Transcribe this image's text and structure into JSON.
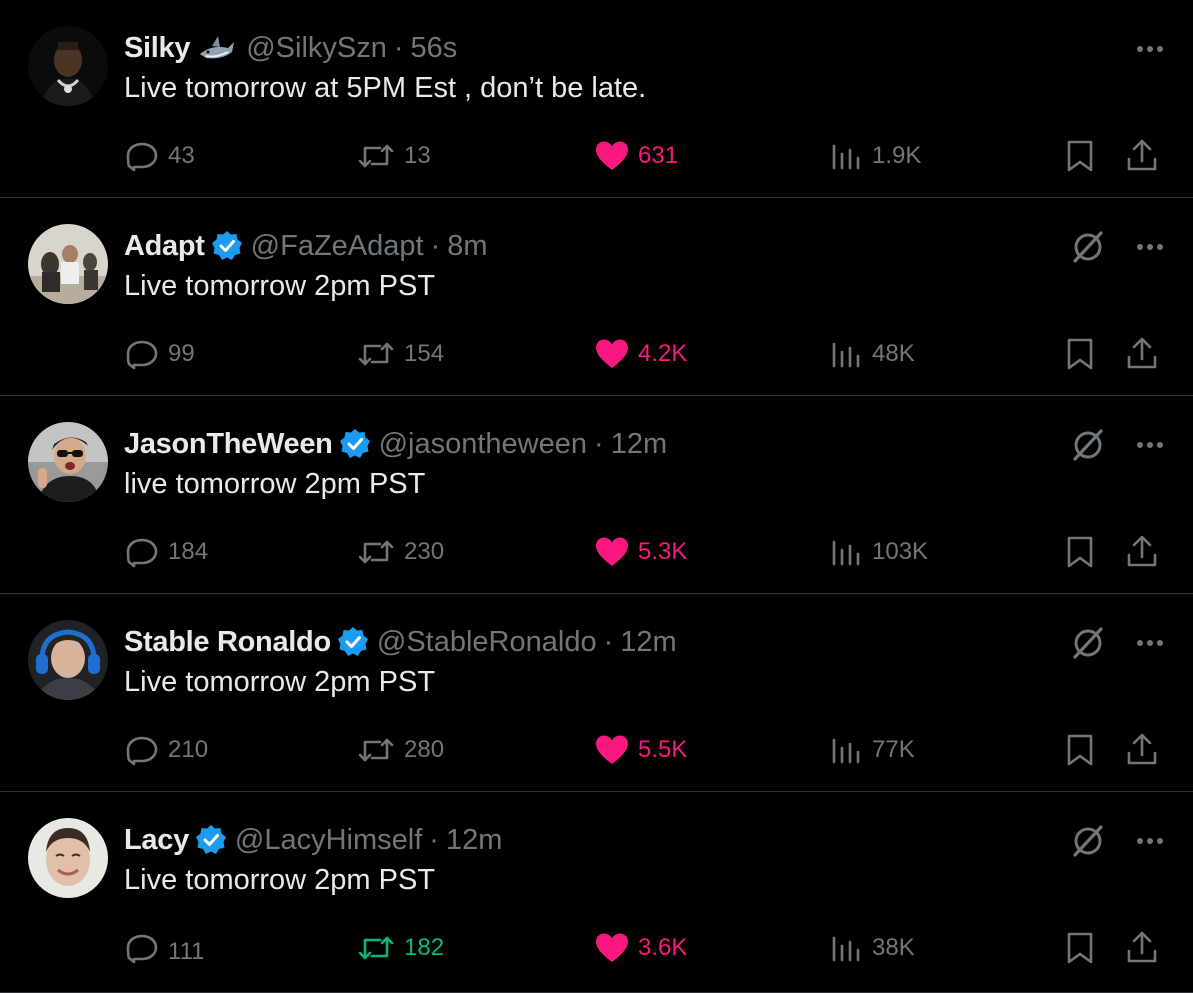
{
  "colors": {
    "background": "#000000",
    "text": "#e7e9ea",
    "muted": "#71767b",
    "like": "#f91880",
    "retweet_active": "#00ba7c",
    "verified": "#1d9bf0",
    "divider": "#2f3336"
  },
  "tweets": [
    {
      "name": "Silky",
      "name_emoji": "shark",
      "handle": "@SilkySzn",
      "sep": "·",
      "time": "56s",
      "text": "Live tomorrow at 5PM Est , don’t be late.",
      "verified": false,
      "grok": false,
      "replies": "43",
      "retweets": "13",
      "likes": "631",
      "views": "1.9K",
      "retweeted": false,
      "liked": true
    },
    {
      "name": "Adapt",
      "handle": "@FaZeAdapt",
      "sep": "·",
      "time": "8m",
      "text": "Live tomorrow 2pm PST",
      "verified": true,
      "grok": true,
      "replies": "99",
      "retweets": "154",
      "likes": "4.2K",
      "views": "48K",
      "retweeted": false,
      "liked": true
    },
    {
      "name": "JasonTheWeen",
      "handle": "@jasontheween",
      "sep": "·",
      "time": "12m",
      "text": "live tomorrow 2pm PST",
      "verified": true,
      "grok": true,
      "replies": "184",
      "retweets": "230",
      "likes": "5.3K",
      "views": "103K",
      "retweeted": false,
      "liked": true
    },
    {
      "name": "Stable Ronaldo",
      "handle": "@StableRonaldo",
      "sep": "·",
      "time": "12m",
      "text": "Live tomorrow 2pm PST",
      "verified": true,
      "grok": true,
      "replies": "210",
      "retweets": "280",
      "likes": "5.5K",
      "views": "77K",
      "retweeted": false,
      "liked": true
    },
    {
      "name": "Lacy",
      "handle": "@LacyHimself",
      "sep": "·",
      "time": "12m",
      "text": "Live tomorrow 2pm PST",
      "verified": true,
      "grok": true,
      "replies": "111",
      "retweets": "182",
      "likes": "3.6K",
      "views": "38K",
      "retweeted": true,
      "liked": true
    }
  ]
}
